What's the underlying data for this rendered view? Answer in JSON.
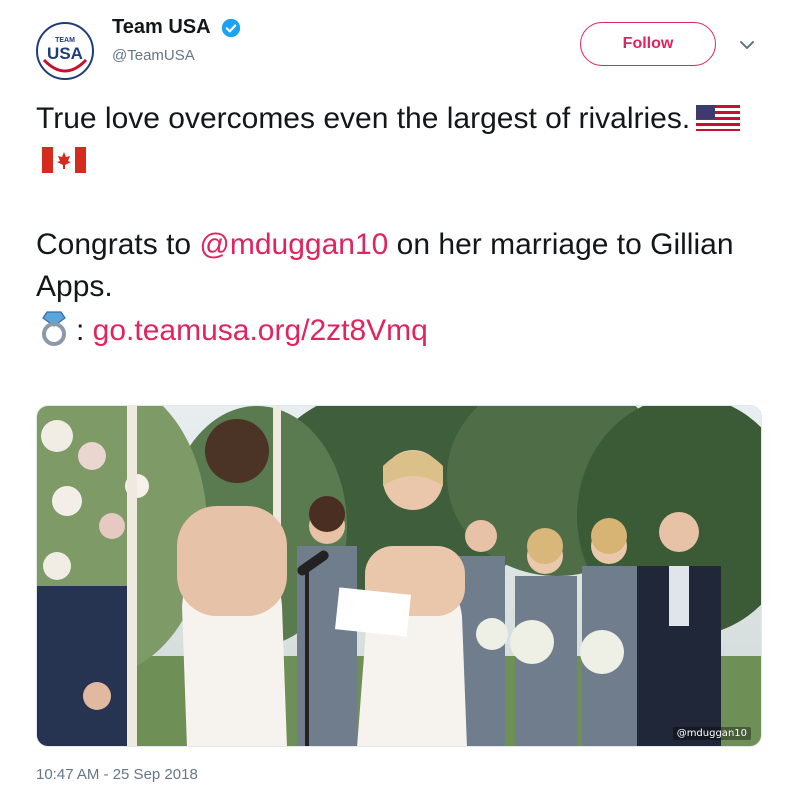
{
  "tweet": {
    "author": {
      "avatar_text_top": "TEAM",
      "avatar_text_main": "USA",
      "display_name": "Team USA",
      "verified": true,
      "handle": "@TeamUSA"
    },
    "follow_label": "Follow",
    "icons": [
      "verified-badge-icon",
      "chevron-down-icon",
      "us-flag-emoji",
      "canada-flag-emoji",
      "ring-emoji"
    ],
    "text": {
      "line1": "True love overcomes even the largest of rivalries.",
      "congrats_prefix": "Congrats to ",
      "mention": "@mduggan10",
      "congrats_suffix": " on her marriage to Gillian Apps.",
      "ring_colon": ": ",
      "url": "go.teamusa.org/2zt8Vmq"
    },
    "image": {
      "alt": "Wedding ceremony photo",
      "watermark": "@mduggan10"
    },
    "timestamp": "10:47 AM - 25 Sep 2018"
  },
  "colors": {
    "accent": "#e0245e",
    "verified": "#1da1f2",
    "muted": "#657786",
    "text": "#14171a"
  }
}
